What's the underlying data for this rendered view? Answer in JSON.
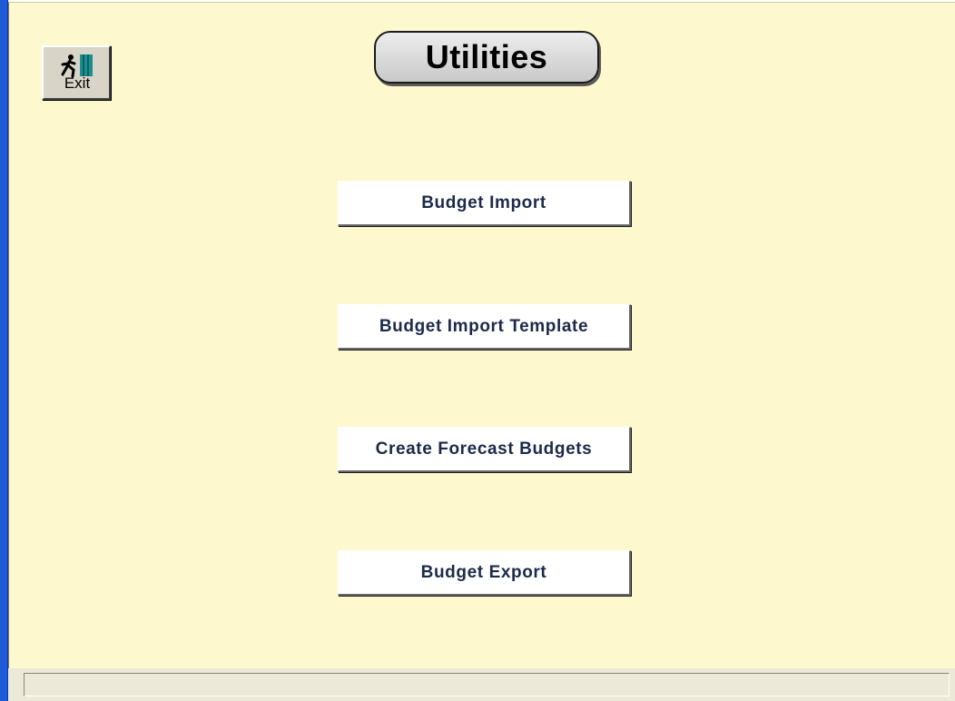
{
  "exit_button": {
    "label": "Exit",
    "icon": "exit-running-man-icon"
  },
  "title": "Utilities",
  "buttons": [
    {
      "label": "Budget Import"
    },
    {
      "label": "Budget Import Template"
    },
    {
      "label": "Create Forecast Budgets"
    },
    {
      "label": "Budget Export"
    }
  ],
  "status_bar": {
    "text": ""
  },
  "colors": {
    "form_background": "#fef8cf",
    "window_border": "#1f5bd8",
    "button_text": "#1c2a4a"
  }
}
